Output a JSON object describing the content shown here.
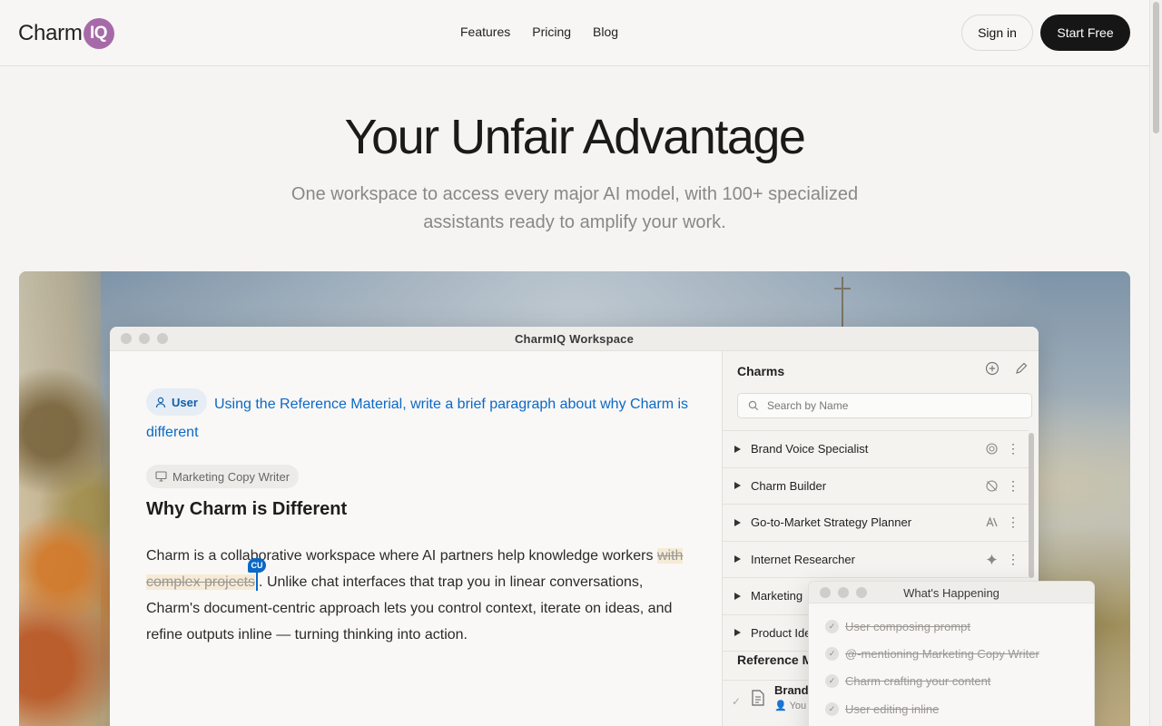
{
  "header": {
    "logo_text": "Charm",
    "logo_badge": "IQ",
    "nav": [
      "Features",
      "Pricing",
      "Blog"
    ],
    "signin": "Sign in",
    "start_free": "Start Free"
  },
  "hero": {
    "title": "Your Unfair Advantage",
    "subtitle": "One workspace to access every major AI model, with 100+ specialized assistants ready to amplify your work."
  },
  "window": {
    "title": "CharmIQ Workspace",
    "doc": {
      "user_chip": "User",
      "prompt": "Using the Reference Material, write a brief paragraph about why Charm is different",
      "assistant_chip": "Marketing Copy Writer",
      "heading": "Why Charm is Different",
      "para_before": "Charm is a collaborative workspace where AI partners help knowledge workers ",
      "para_struck": "with complex projects",
      "para_after": ". Unlike chat interfaces that trap you in linear conversations, Charm's document-centric approach lets you control context, iterate on ideas, and refine outputs inline — turning thinking into action.",
      "cursor_badge": "CU"
    },
    "charms": {
      "title": "Charms",
      "search_placeholder": "Search by Name",
      "items": [
        {
          "label": "Brand Voice Specialist",
          "model_icon": "openai-icon"
        },
        {
          "label": "Charm Builder",
          "model_icon": "openai-off-icon"
        },
        {
          "label": "Go-to-Market Strategy Planner",
          "model_icon": "anthropic-icon"
        },
        {
          "label": "Internet Researcher",
          "model_icon": "sparkle-icon"
        },
        {
          "label": "Marketing",
          "model_icon": ""
        },
        {
          "label": "Product Ide",
          "model_icon": ""
        }
      ],
      "reference_title": "Reference M",
      "reference_item": {
        "name": "Brand",
        "by": "You"
      }
    }
  },
  "happening": {
    "title": "What's Happening",
    "items": [
      "User composing prompt",
      "@-mentioning Marketing Copy Writer",
      "Charm crafting your content",
      "User editing inline"
    ]
  }
}
